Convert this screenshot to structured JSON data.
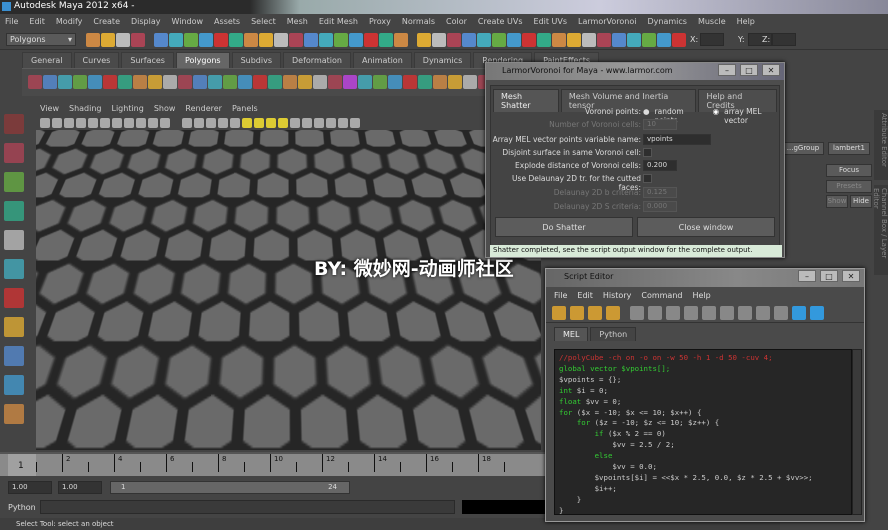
{
  "app": {
    "title": "Autodesk Maya 2012 x64 -"
  },
  "menubar": [
    "File",
    "Edit",
    "Modify",
    "Create",
    "Display",
    "Window",
    "Assets",
    "Select",
    "Mesh",
    "Edit Mesh",
    "Proxy",
    "Normals",
    "Color",
    "Create UVs",
    "Edit UVs",
    "LarmorVoronoi",
    "Dynamics",
    "Muscle",
    "Help"
  ],
  "statusline": {
    "mode": "Polygons",
    "x_label": "X:",
    "y_label": "Y:",
    "z_label": "Z:"
  },
  "shelf_tabs": [
    {
      "label": "General"
    },
    {
      "label": "Curves"
    },
    {
      "label": "Surfaces"
    },
    {
      "label": "Polygons",
      "active": true
    },
    {
      "label": "Subdivs"
    },
    {
      "label": "Deformation"
    },
    {
      "label": "Animation"
    },
    {
      "label": "Dynamics"
    },
    {
      "label": "Rendering"
    },
    {
      "label": "PaintEffects"
    }
  ],
  "viewport": {
    "menu": [
      "View",
      "Shading",
      "Lighting",
      "Show",
      "Renderer",
      "Panels"
    ],
    "camera": "persp",
    "colors": {
      "hex_top": "#5a5a5a",
      "background": "#6d7784",
      "selected": "#3fe08a"
    }
  },
  "watermark": "BY: 微妙网-动画师社区",
  "timeline": {
    "current_frame": "1",
    "ticks": [
      "2",
      "4",
      "6",
      "8",
      "10",
      "12",
      "14",
      "16",
      "18"
    ]
  },
  "range": {
    "start": "1.00",
    "playback_start": "1.00",
    "slider_start": "1",
    "slider_end": "24"
  },
  "cmdline": {
    "label": "Python"
  },
  "helpline": "Select Tool: select an object",
  "rightpanel": {
    "tab1": "...gGroup",
    "tab2": "lambert1",
    "focus": "Focus",
    "presets": "Presets",
    "show": "Show",
    "hide": "Hide",
    "vtab1": "Attribute Editor",
    "vtab2": "Channel Box / Layer Editor"
  },
  "voronoi": {
    "title": "LarmorVoronoi for Maya - www.larmor.com",
    "tabs": [
      {
        "label": "Mesh Shatter",
        "active": true
      },
      {
        "label": "Mesh Volume and Inertia tensor"
      },
      {
        "label": "Help and Credits"
      }
    ],
    "voronoi_points_label": "Voronoi points:",
    "radio_random": "random points",
    "radio_array": "array MEL vector",
    "selected": "array MEL vector",
    "num_cells_label": "Number of Voronoi cells:",
    "num_cells": "10",
    "array_name_label": "Array MEL vector points variable name:",
    "array_name": "vpoints",
    "disjoint_label": "Disjoint surface in same Voronoi cell:",
    "disjoint": false,
    "explode_label": "Explode distance of Voronoi cells:",
    "explode": "0.200",
    "delaunay_label": "Use Delaunay 2D tr. for the cutted faces:",
    "delaunay": false,
    "delaunay_b_label": "Delaunay 2D b criteria:",
    "delaunay_b": "0.125",
    "delaunay_s_label": "Delaunay 2D S criteria:",
    "delaunay_s": "0.000",
    "do_shatter": "Do Shatter",
    "close": "Close window",
    "status": "Shatter completed, see the script output window for the complete output."
  },
  "script_editor": {
    "title": "Script Editor",
    "menu": [
      "File",
      "Edit",
      "History",
      "Command",
      "Help"
    ],
    "tabs": [
      {
        "label": "MEL",
        "active": true
      },
      {
        "label": "Python"
      }
    ],
    "code": [
      {
        "t": "//polyCube -ch on -o on -w 50 -h 1 -d 50 -cuv 4;",
        "c": "cm"
      },
      {
        "t": "global vector $vpoints[];",
        "c": "kw"
      },
      {
        "t": "$vpoints = {};",
        "c": ""
      },
      {
        "k": "int",
        "t": " $i = 0;"
      },
      {
        "k": "float",
        "t": " $vv = 0;"
      },
      {
        "k": "for",
        "t": " ($x = -10; $x <= 10; $x++) {"
      },
      {
        "i": "    ",
        "k": "for",
        "t": " ($z = -10; $z <= 10; $z++) {"
      },
      {
        "i": "        ",
        "k": "if",
        "t": " ($x % 2 == 0)"
      },
      {
        "t": "            $vv = 2.5 / 2;",
        "c": ""
      },
      {
        "i": "        ",
        "k": "else",
        "t": ""
      },
      {
        "t": "            $vv = 0.0;",
        "c": ""
      },
      {
        "t": "        $vpoints[$i] = <<$x * 2.5, 0.0, $z * 2.5 + $vv>>;",
        "c": ""
      },
      {
        "t": "        $i++;",
        "c": ""
      },
      {
        "t": "    }",
        "c": ""
      },
      {
        "t": "}",
        "c": ""
      }
    ]
  }
}
